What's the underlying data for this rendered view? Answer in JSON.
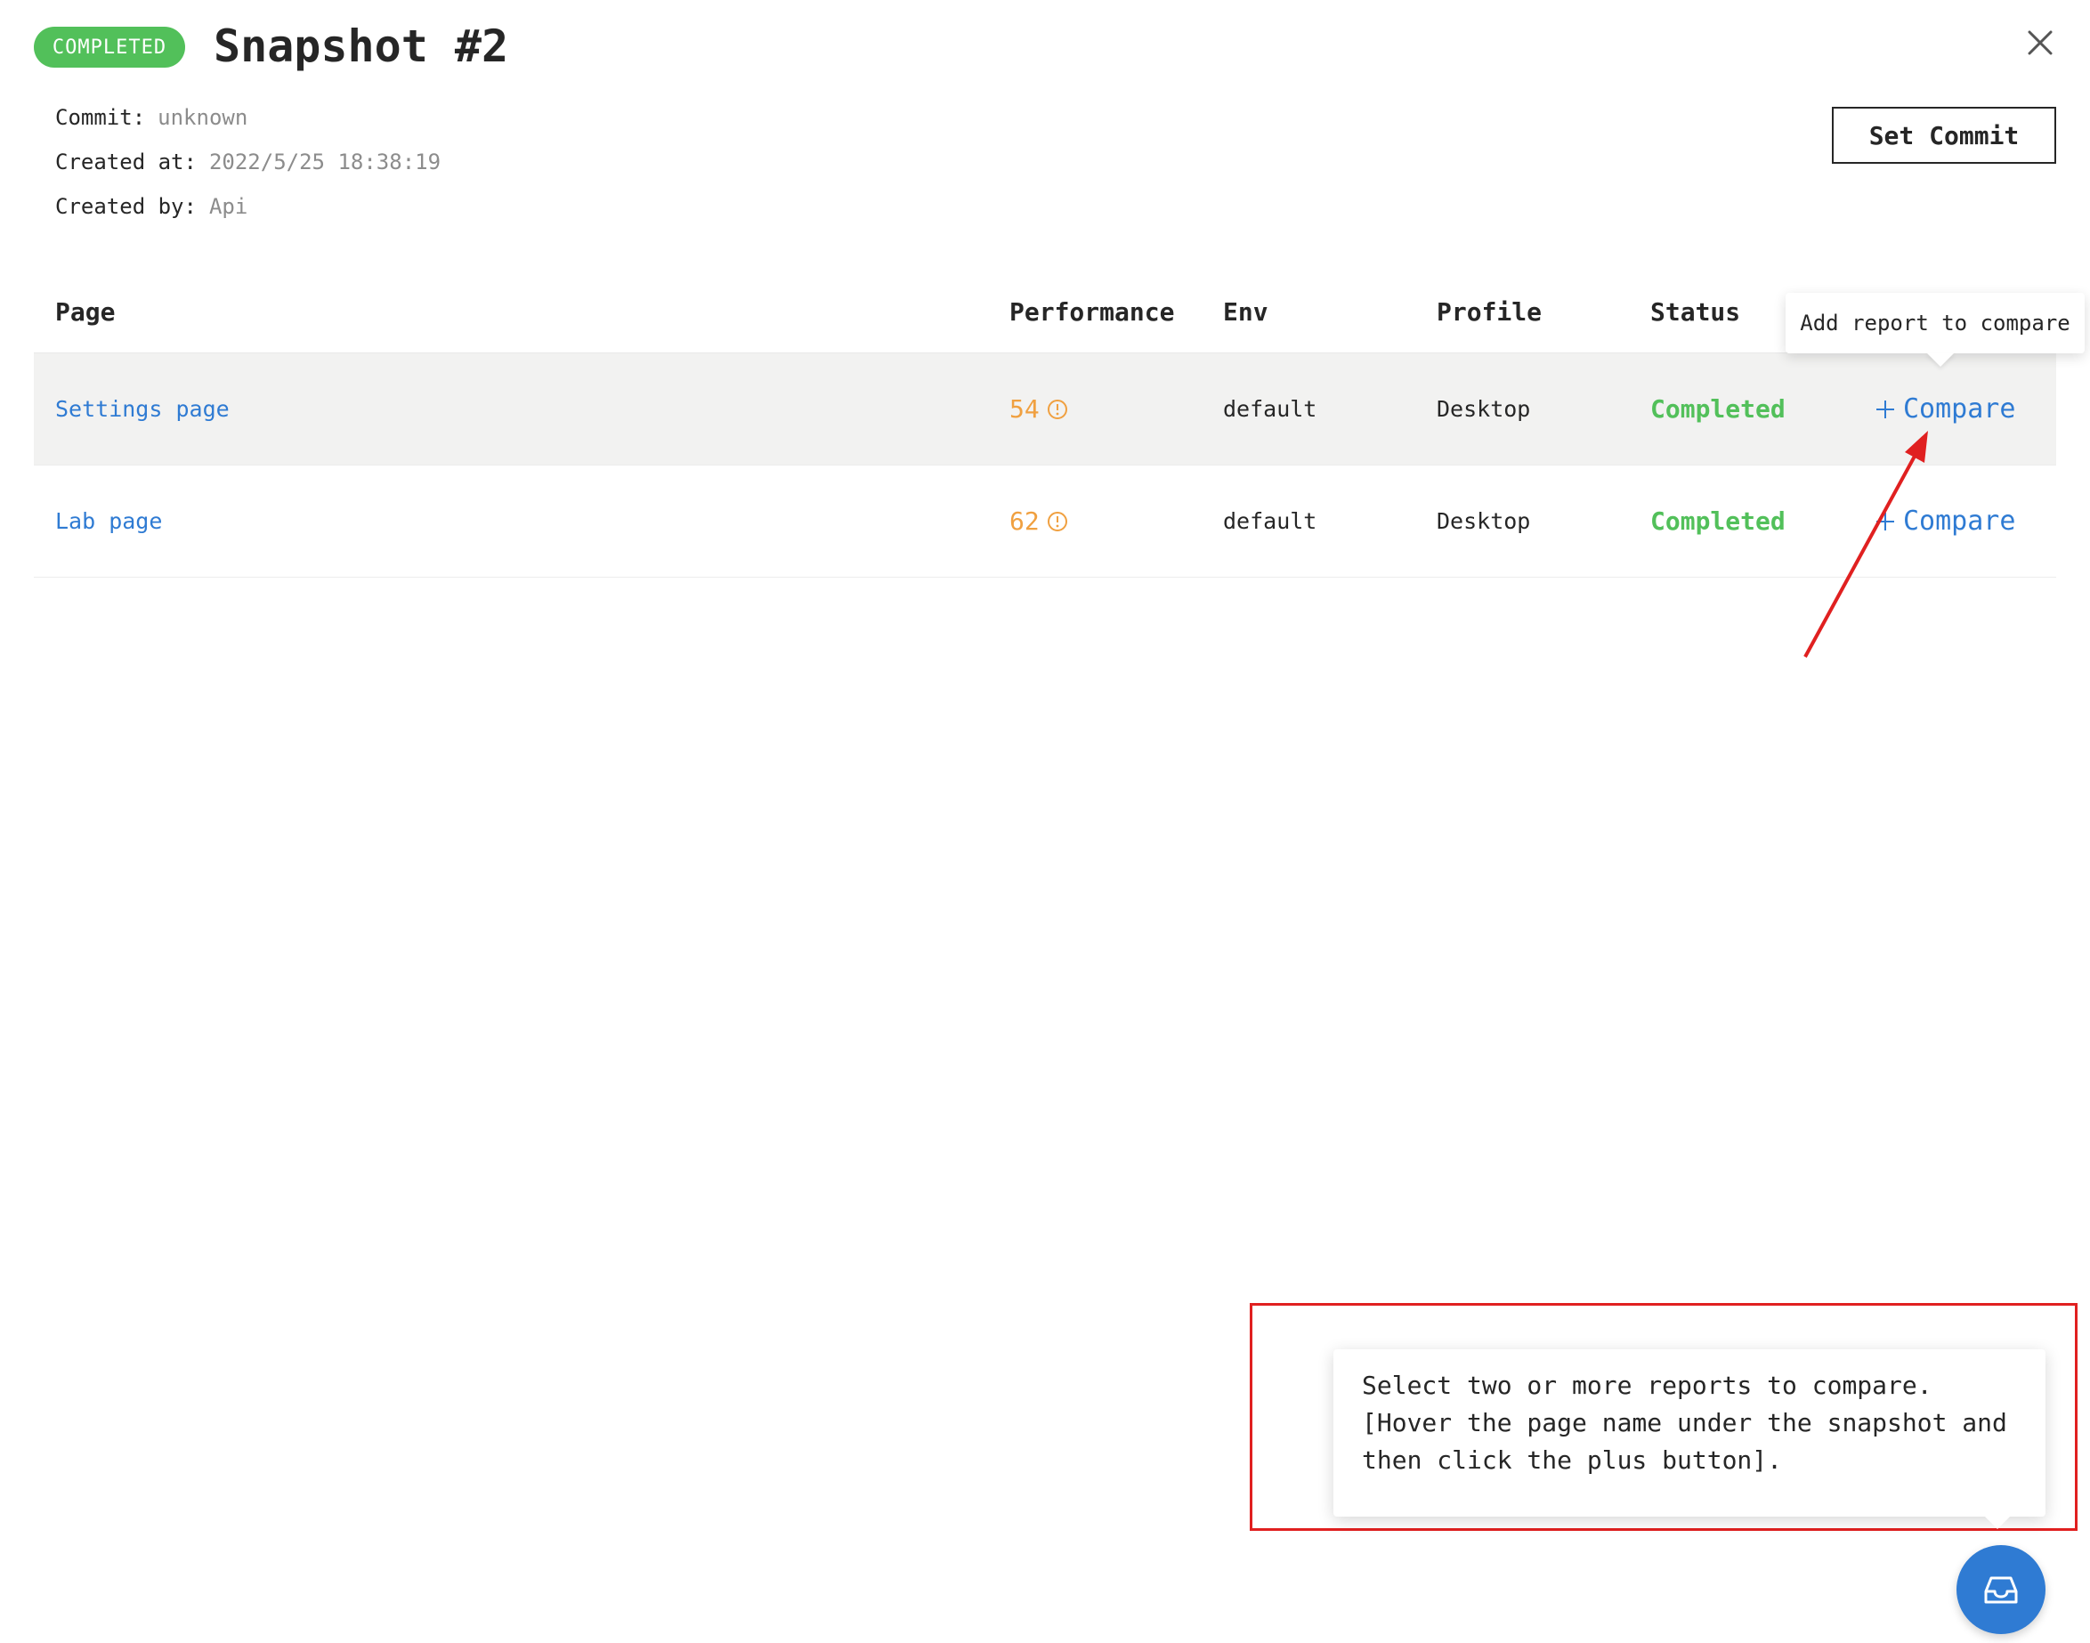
{
  "header": {
    "status_badge": "COMPLETED",
    "title": "Snapshot #2",
    "set_commit_label": "Set Commit"
  },
  "meta": {
    "commit_label": "Commit:",
    "commit_value": "unknown",
    "created_at_label": "Created at:",
    "created_at_value": "2022/5/25 18:38:19",
    "created_by_label": "Created by:",
    "created_by_value": "Api"
  },
  "table": {
    "columns": [
      "Page",
      "Performance",
      "Env",
      "Profile",
      "Status"
    ],
    "rows": [
      {
        "page": "Settings page",
        "performance": "54",
        "env": "default",
        "profile": "Desktop",
        "status": "Completed",
        "action": "Compare"
      },
      {
        "page": "Lab page",
        "performance": "62",
        "env": "default",
        "profile": "Desktop",
        "status": "Completed",
        "action": "Compare"
      }
    ]
  },
  "tooltip_compare": "Add report to compare",
  "compare_hint": {
    "line1": "Select two or more reports to compare.",
    "line2": "[Hover the page name under the snapshot and",
    "line3": "then click the plus button]."
  },
  "colors": {
    "accent_blue": "#2f7bd3",
    "success_green": "#52c05a",
    "warning_orange": "#f0a040",
    "annotation_red": "#e02020"
  },
  "icons": [
    "close-icon",
    "warning-circle-icon",
    "plus-icon",
    "inbox-icon"
  ]
}
